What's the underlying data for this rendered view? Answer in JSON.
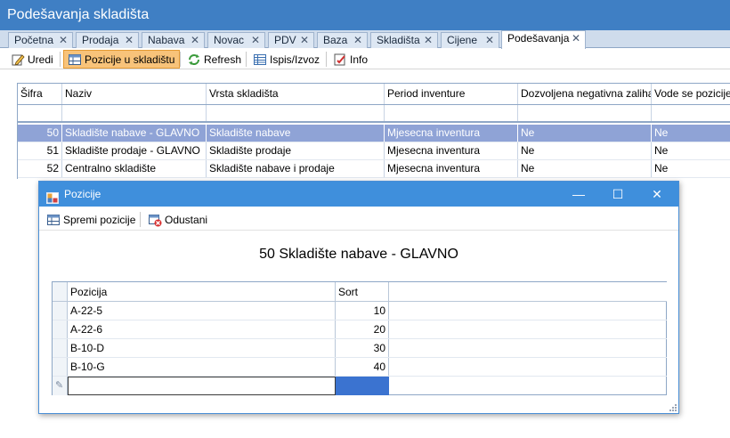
{
  "app": {
    "title": "Podešavanja skladišta"
  },
  "tabs": [
    {
      "label": "Početna",
      "active": false
    },
    {
      "label": "Prodaja",
      "active": false
    },
    {
      "label": "Nabava",
      "active": false
    },
    {
      "label": "Novac",
      "active": false
    },
    {
      "label": "PDV",
      "active": false
    },
    {
      "label": "Baza",
      "active": false
    },
    {
      "label": "Skladišta",
      "active": false
    },
    {
      "label": "Cijene",
      "active": false
    },
    {
      "label": "Podešavanja",
      "active": true
    }
  ],
  "tab_close_glyph": "✕",
  "toolbar": {
    "items": [
      {
        "label": "Uredi",
        "icon": "edit-icon"
      },
      {
        "label": "Pozicije u skladištu",
        "icon": "grid-icon",
        "pressed": true
      },
      {
        "label": "Refresh",
        "icon": "refresh-icon"
      },
      {
        "label": "Ispis/Izvoz",
        "icon": "print-icon"
      },
      {
        "label": "Info",
        "icon": "info-icon"
      }
    ]
  },
  "main_grid": {
    "columns": [
      "Šifra",
      "Naziv",
      "Vrsta skladišta",
      "Period inventure",
      "Dozvoljena negativna zaliha",
      "Vode se pozicije"
    ],
    "rows": [
      {
        "sifra": "50",
        "naziv": "Skladište nabave - GLAVNO",
        "vrsta": "Skladište nabave",
        "period": "Mjesecna inventura",
        "negativna": "Ne",
        "pozicije": "Ne",
        "selected": true
      },
      {
        "sifra": "51",
        "naziv": "Skladište prodaje - GLAVNO",
        "vrsta": "Skladište prodaje",
        "period": "Mjesecna inventura",
        "negativna": "Ne",
        "pozicije": "Ne",
        "selected": false
      },
      {
        "sifra": "52",
        "naziv": "Centralno skladište",
        "vrsta": "Skladište nabave i prodaje",
        "period": "Mjesecna inventura",
        "negativna": "Ne",
        "pozicije": "Ne",
        "selected": false
      }
    ]
  },
  "dialog": {
    "title": "Pozicije",
    "window_buttons": {
      "minimize": "—",
      "maximize": "☐",
      "close": "✕"
    },
    "toolbar": {
      "save_label": "Spremi pozicije",
      "cancel_label": "Odustani"
    },
    "heading": "50 Skladište nabave - GLAVNO",
    "grid": {
      "columns": [
        "Pozicija",
        "Sort"
      ],
      "rows": [
        {
          "pozicija": "A-22-5",
          "sort": "10"
        },
        {
          "pozicija": "A-22-6",
          "sort": "20"
        },
        {
          "pozicija": "B-10-D",
          "sort": "30"
        },
        {
          "pozicija": "B-10-G",
          "sort": "40"
        }
      ],
      "new_row": {
        "pozicija": "",
        "sort": ""
      },
      "new_row_indicator": "✎"
    }
  },
  "colors": {
    "title_bar": "#3f7fc4",
    "dialog_title_bar": "#3f8fdc",
    "selected_row": "#8fa3d6",
    "pressed_button": "#f8c37a",
    "new_row_sort_cell": "#3b73d0"
  }
}
